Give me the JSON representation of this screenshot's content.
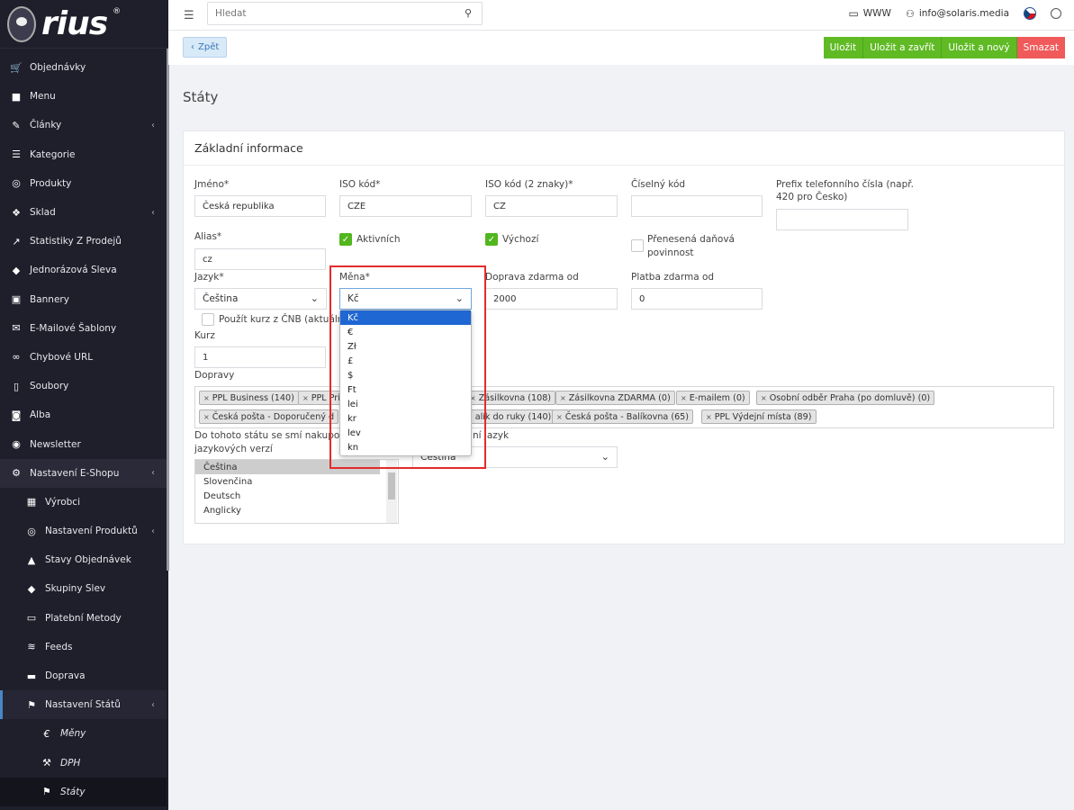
{
  "logo": {
    "text": "rius",
    "mark": "®"
  },
  "sidebar": {
    "items": [
      {
        "label": "Objednávky",
        "icon": "cart-icon",
        "level": 0
      },
      {
        "label": "Menu",
        "icon": "folder-icon",
        "level": 0
      },
      {
        "label": "Články",
        "icon": "pencil-icon",
        "level": 0,
        "chevron": "‹"
      },
      {
        "label": "Kategorie",
        "icon": "list-icon",
        "level": 0
      },
      {
        "label": "Produkty",
        "icon": "dribbble-icon",
        "level": 0
      },
      {
        "label": "Sklad",
        "icon": "dropbox-icon",
        "level": 0,
        "chevron": "‹"
      },
      {
        "label": "Statistiky Z Prodejů",
        "icon": "chart-icon",
        "level": 0
      },
      {
        "label": "Jednorázová Sleva",
        "icon": "tag-icon",
        "level": 0
      },
      {
        "label": "Bannery",
        "icon": "image-icon",
        "level": 0
      },
      {
        "label": "E-Mailové Šablony",
        "icon": "envelope-icon",
        "level": 0
      },
      {
        "label": "Chybové URL",
        "icon": "link-icon",
        "level": 0
      },
      {
        "label": "Soubory",
        "icon": "file-icon",
        "level": 0
      },
      {
        "label": "Alba",
        "icon": "camera-icon",
        "level": 0
      },
      {
        "label": "Newsletter",
        "icon": "mail-circle-icon",
        "level": 0
      },
      {
        "label": "Nastavení E-Shopu",
        "icon": "cogs-icon",
        "level": 0,
        "chevron": "‹"
      },
      {
        "label": "Výrobci",
        "icon": "building-icon",
        "level": 1
      },
      {
        "label": "Nastavení Produktů",
        "icon": "dribbble-icon",
        "level": 1,
        "chevron": "‹"
      },
      {
        "label": "Stavy Objednávek",
        "icon": "bell-icon",
        "level": 1
      },
      {
        "label": "Skupiny Slev",
        "icon": "tags-icon",
        "level": 1
      },
      {
        "label": "Platební Metody",
        "icon": "credit-card-icon",
        "level": 1
      },
      {
        "label": "Feeds",
        "icon": "rss-icon",
        "level": 1
      },
      {
        "label": "Doprava",
        "icon": "truck-icon",
        "level": 1
      },
      {
        "label": "Nastavení Států",
        "icon": "flag-icon",
        "level": 1,
        "chevron": "‹"
      },
      {
        "label": "Měny",
        "icon": "euro-icon",
        "level": 2
      },
      {
        "label": "DPH",
        "icon": "gavel-icon",
        "level": 2
      },
      {
        "label": "Státy",
        "icon": "flag-icon",
        "level": 2
      }
    ]
  },
  "topbar": {
    "search_placeholder": "Hledat",
    "www": "WWW",
    "user": "info@solaris.media"
  },
  "actions": {
    "back": "Zpět",
    "save": "Uložit",
    "save_close": "Uložit a zavřít",
    "save_new": "Uložit a nový",
    "delete": "Smazat"
  },
  "page_title": "Státy",
  "card_title": "Základní informace",
  "form": {
    "name_label": "Jméno*",
    "name_value": "Česká republika",
    "iso_label": "ISO kód*",
    "iso_value": "CZE",
    "iso2_label": "ISO kód (2 znaky)*",
    "iso2_value": "CZ",
    "numeric_label": "Číselný kód",
    "numeric_value": "",
    "prefix_label_1": "Prefix telefonního čísla (např.",
    "prefix_label_2": "420 pro Česko)",
    "prefix_value": "",
    "alias_label": "Alias*",
    "alias_value": "cz",
    "active_label": "Aktivních",
    "default_label": "Výchozí",
    "reverse_label_1": "Přenesená daňová",
    "reverse_label_2": "povinnost",
    "lang_label": "Jazyk*",
    "lang_value": "Čeština",
    "currency_label": "Měna*",
    "currency_value": "Kč",
    "free_ship_label": "Doprava zdarma od",
    "free_ship_value": "2000",
    "free_pay_label": "Platba zdarma od",
    "free_pay_value": "0",
    "cnb_label": "Použít kurz z ČNB (aktuální k",
    "rate_label": "Kurz",
    "rate_value": "1",
    "shipping_label": "Dopravy",
    "langs_allowed_label_1": "Do tohoto státu se smí nakupova",
    "langs_allowed_label_2": "jazykových verzí",
    "default_lang_label_fragment": "ní jazyk",
    "default_lang_value_fragment": "Čeština"
  },
  "shipping_tags": [
    "PPL Business (140)",
    "PPL Priv",
    "Zásilkovna (108)",
    "Zásilkovna ZDARMA (0)",
    "E-mailem (0)",
    "Osobní odběr Praha (po domluvě) (0)",
    "Česká pošta - Doporučený d",
    "alík do ruky (140)",
    "Česká pošta - Balíkovna (65)",
    "PPL Výdejní místa (89)"
  ],
  "languages": [
    "Čeština",
    "Slovenčina",
    "Deutsch",
    "Anglicky"
  ],
  "currency_options": [
    "Kč",
    "€",
    "Zł",
    "£",
    "$",
    "Ft",
    "lei",
    "kr",
    "lev",
    "kn"
  ],
  "colors": {
    "accent_green": "#5fba24",
    "danger_red": "#f05a5a",
    "sidebar_bg": "#1f1f2b",
    "highlight": "#e52b2b",
    "option_hl": "#1f67d2"
  }
}
